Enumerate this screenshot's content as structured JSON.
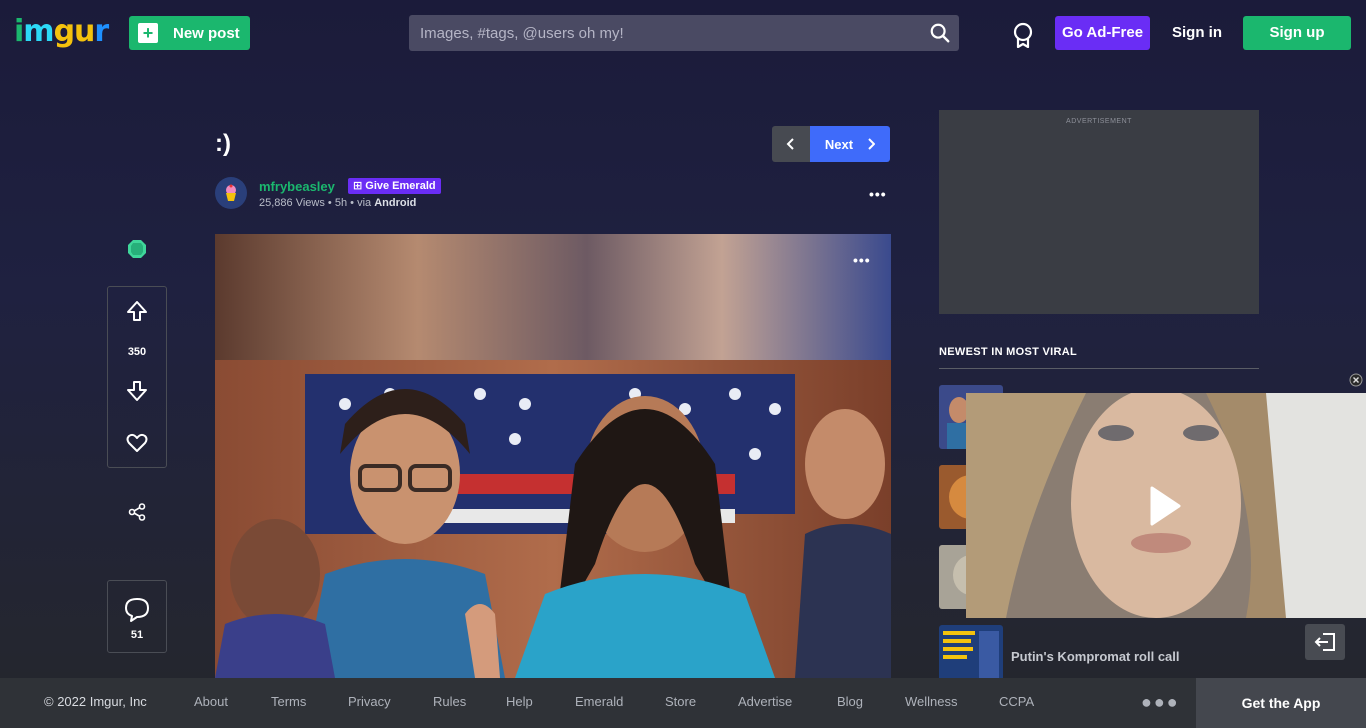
{
  "header": {
    "logo_letters": [
      "i",
      "m",
      "g",
      "u",
      "r"
    ],
    "new_post_label": "New post",
    "search_placeholder": "Images, #tags, @users oh my!",
    "go_ad_free_label": "Go Ad-Free",
    "sign_in_label": "Sign in",
    "sign_up_label": "Sign up"
  },
  "post": {
    "title": ":)",
    "next_label": "Next",
    "username": "mfrybeasley",
    "give_emerald_label": "Give Emerald",
    "views": "25,886 Views",
    "age": "5h",
    "via": "via",
    "platform": "Android",
    "sep": "•"
  },
  "actions": {
    "votes": "350",
    "comments": "51"
  },
  "sidebar": {
    "ad_label": "ADVERTISEMENT",
    "newest_heading": "NEWEST IN MOST VIRAL",
    "items": [
      {
        "title": "Putin's Kompromat roll call"
      }
    ]
  },
  "footer": {
    "copyright": "© 2022 Imgur, Inc",
    "links": [
      "About",
      "Terms",
      "Privacy",
      "Rules",
      "Help",
      "Emerald",
      "Store",
      "Advertise",
      "Blog",
      "Wellness",
      "CCPA"
    ],
    "get_app_label": "Get the App"
  },
  "colors": {
    "brand_green": "#1bb76e",
    "purple": "#6a2df5",
    "next_blue": "#3f6bfa"
  }
}
